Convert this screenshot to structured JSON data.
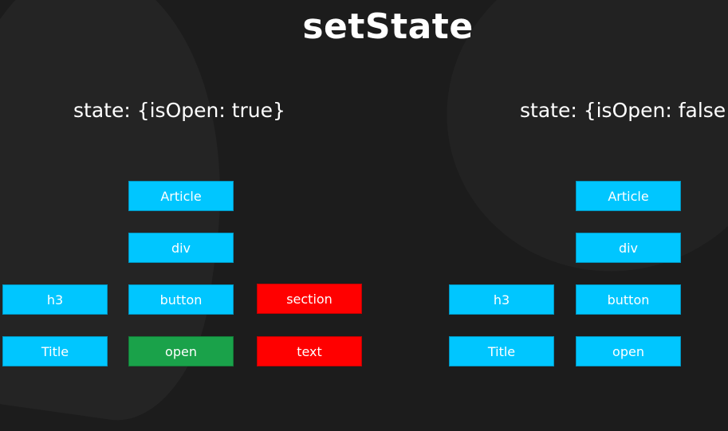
{
  "title": "setState",
  "colors": {
    "background": "#1c1c1c",
    "node_default": "#00c6ff",
    "node_changed_text": "#1aa24a",
    "node_removed": "#ff0000"
  },
  "left_tree": {
    "state_label": "state: {isOpen: true}",
    "nodes": {
      "article": "Article",
      "div": "div",
      "h3": "h3",
      "button": "button",
      "section": "section",
      "title": "Title",
      "open": "open",
      "text": "text"
    }
  },
  "right_tree": {
    "state_label": "state: {isOpen: false}",
    "nodes": {
      "article": "Article",
      "div": "div",
      "h3": "h3",
      "button": "button",
      "title": "Title",
      "open": "open"
    }
  }
}
